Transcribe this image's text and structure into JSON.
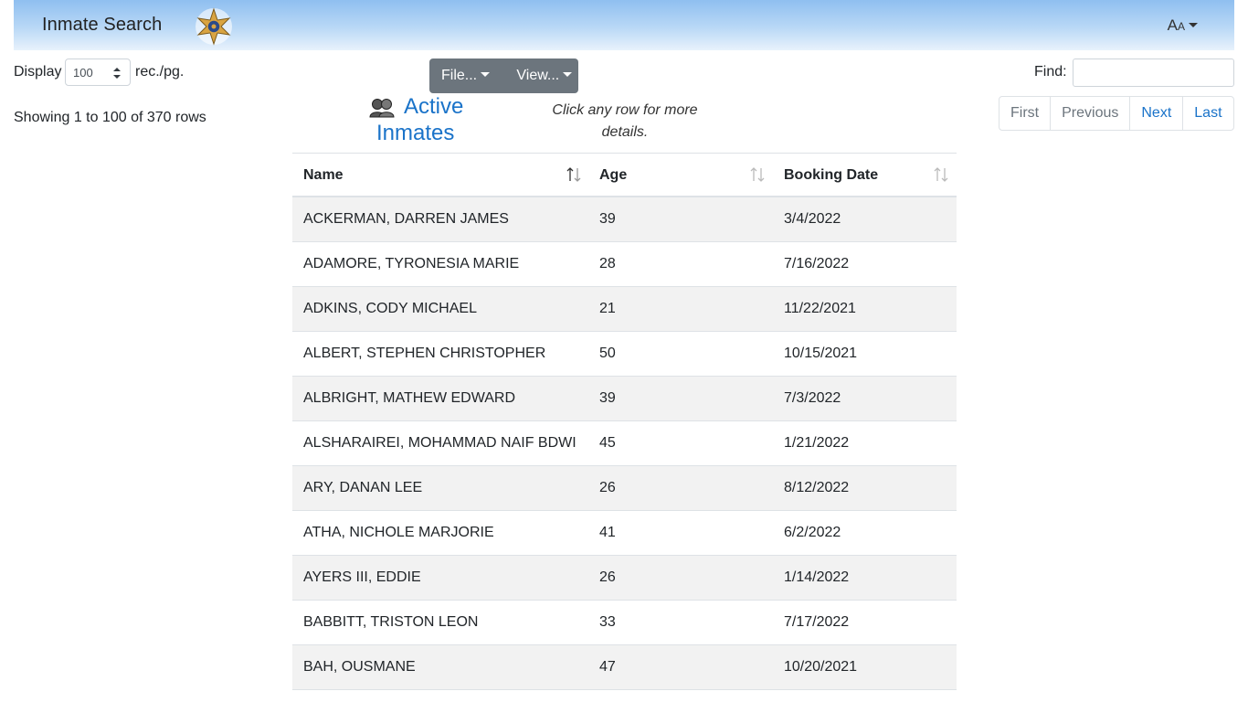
{
  "header": {
    "title": "Inmate Search",
    "font_toggle_big": "A",
    "font_toggle_small": "A"
  },
  "controls": {
    "display_label": "Display",
    "per_page_value": "100",
    "per_page_suffix": "rec./pg.",
    "file_button": "File...",
    "view_button": "View...",
    "find_label": "Find:",
    "find_value": "",
    "showing_text": "Showing 1 to 100 of 370 rows"
  },
  "title": {
    "line1": "Active",
    "line2": "Inmates",
    "hint": "Click any row for more details."
  },
  "pagination": {
    "first": "First",
    "previous": "Previous",
    "next": "Next",
    "last": "Last"
  },
  "table": {
    "columns": [
      "Name",
      "Age",
      "Booking Date"
    ],
    "rows": [
      {
        "name": "ACKERMAN, DARREN JAMES",
        "age": "39",
        "date": "3/4/2022"
      },
      {
        "name": "ADAMORE, TYRONESIA MARIE",
        "age": "28",
        "date": "7/16/2022"
      },
      {
        "name": "ADKINS, CODY MICHAEL",
        "age": "21",
        "date": "11/22/2021"
      },
      {
        "name": "ALBERT, STEPHEN CHRISTOPHER",
        "age": "50",
        "date": "10/15/2021"
      },
      {
        "name": "ALBRIGHT, MATHEW EDWARD",
        "age": "39",
        "date": "7/3/2022"
      },
      {
        "name": "ALSHARAIREI, MOHAMMAD NAIF BDWI",
        "age": "45",
        "date": "1/21/2022"
      },
      {
        "name": "ARY, DANAN LEE",
        "age": "26",
        "date": "8/12/2022"
      },
      {
        "name": "ATHA, NICHOLE MARJORIE",
        "age": "41",
        "date": "6/2/2022"
      },
      {
        "name": "AYERS III, EDDIE",
        "age": "26",
        "date": "1/14/2022"
      },
      {
        "name": "BABBITT, TRISTON LEON",
        "age": "33",
        "date": "7/17/2022"
      },
      {
        "name": "BAH, OUSMANE",
        "age": "47",
        "date": "10/20/2021"
      }
    ]
  },
  "colors": {
    "accent": "#1a73c9",
    "header_top": "#8fbff0",
    "button_bg": "#6c757d",
    "row_stripe": "#f2f2f2"
  }
}
